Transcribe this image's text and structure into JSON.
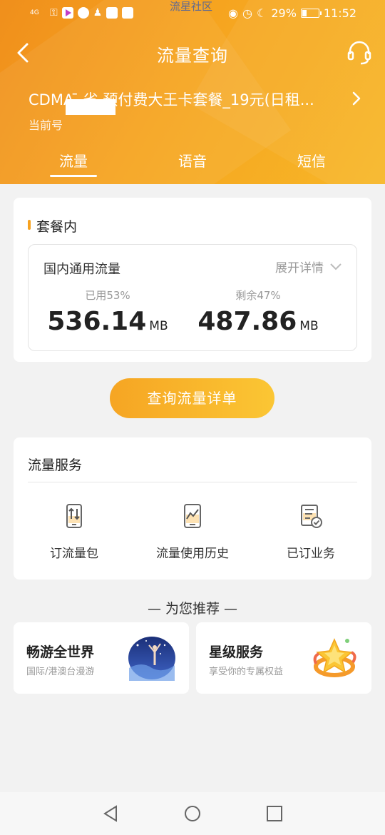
{
  "status_bar": {
    "signal": "4G",
    "center_text": "流星社区",
    "battery": "29%",
    "battery_level": 0.29,
    "time": "11:52"
  },
  "nav": {
    "title": "流量查询",
    "back_icon": "chevron-left-icon",
    "service_icon": "headset-icon"
  },
  "account": {
    "plan_name": "CDMA  ̄ 省 预付费大王卡套餐_19元(日租...",
    "sub_label": "当前号"
  },
  "tabs": [
    {
      "label": "流量",
      "active": true
    },
    {
      "label": "语音",
      "active": false
    },
    {
      "label": "短信",
      "active": false
    }
  ],
  "package": {
    "section_title": "套餐内",
    "data_type": "国内通用流量",
    "expand_label": "展开详情",
    "used_label": "已用53%",
    "used_value": "536.14",
    "remaining_label": "剩余47%",
    "remaining_value": "487.86",
    "unit": "MB"
  },
  "query_button": "查询流量详单",
  "services": {
    "title": "流量服务",
    "items": [
      {
        "label": "订流量包",
        "icon": "phone-data-icon"
      },
      {
        "label": "流量使用历史",
        "icon": "usage-chart-icon"
      },
      {
        "label": "已订业务",
        "icon": "subscribed-list-icon"
      }
    ]
  },
  "recommend": {
    "title": "— 为您推荐 —",
    "cards": [
      {
        "title": "畅游全世界",
        "subtitle": "国际/港澳台漫游",
        "image": "travel-illustration"
      },
      {
        "title": "星级服务",
        "subtitle": "享受你的专属权益",
        "image": "star-illustration"
      }
    ]
  },
  "colors": {
    "brand": "#f6a41f",
    "button_gradient_start": "#f6a523",
    "button_gradient_end": "#fbc634"
  }
}
